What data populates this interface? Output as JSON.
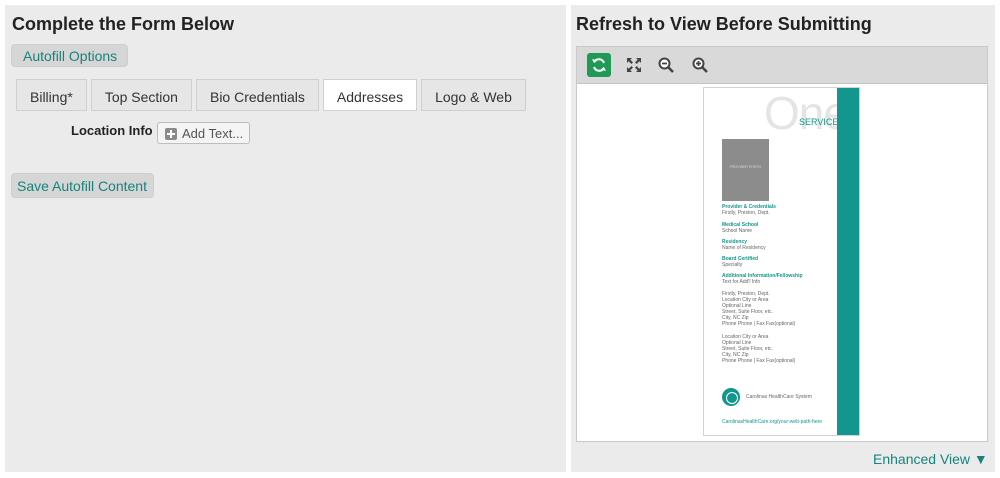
{
  "left": {
    "title": "Complete the Form Below",
    "autofill_options": "Autofill Options",
    "tabs": [
      {
        "label": "Billing*",
        "active": false
      },
      {
        "label": "Top Section",
        "active": false
      },
      {
        "label": "Bio Credentials",
        "active": false
      },
      {
        "label": "Addresses",
        "active": true
      },
      {
        "label": "Logo & Web",
        "active": false
      }
    ],
    "location_info_label": "Location Info",
    "add_text_button": "Add Text...",
    "save_autofill": "Save Autofill Content"
  },
  "right": {
    "title": "Refresh to View Before Submitting",
    "toolbar_icons": [
      "refresh-icon",
      "fullscreen-icon",
      "zoom-out-icon",
      "zoom-in-icon"
    ],
    "enhanced_view": "Enhanced View ▼",
    "preview": {
      "big_word": "One",
      "service": "SERVICE",
      "photo_placeholder": "PROVIDER PHOTO",
      "blocks": [
        {
          "head": "Provider & Credentials",
          "lines": [
            "Firstly, Preston, Dept."
          ]
        },
        {
          "head": "Medical School",
          "lines": [
            "School Name"
          ]
        },
        {
          "head": "Residency",
          "lines": [
            "Name of Residency"
          ]
        },
        {
          "head": "Board Certified",
          "lines": [
            "Specialty"
          ]
        },
        {
          "head": "Additional Information/Fellowship",
          "lines": [
            "Text for Add'l Info"
          ]
        },
        {
          "head": "",
          "lines": [
            "Firstly, Preston, Dept.",
            "Location City or Area",
            "Optional Line",
            "Street, Suite Floor, etc.",
            "City, NC Zip",
            "Phone Phone | Fax Fax(optional)"
          ]
        },
        {
          "head": "",
          "lines": [
            "Location City or Area",
            "Optional Line",
            "Street, Suite Floor, etc.",
            "City, NC Zip",
            "Phone Phone | Fax Fax(optional)"
          ]
        }
      ],
      "logo_text": "Carolinas HealthCare System",
      "url": "CarolinasHealthCare.org/your-web-path-here"
    }
  },
  "colors": {
    "accent": "#16837c",
    "teal_band": "#13968d",
    "refresh_green": "#1f9a55",
    "panel_bg": "#ebebeb"
  }
}
